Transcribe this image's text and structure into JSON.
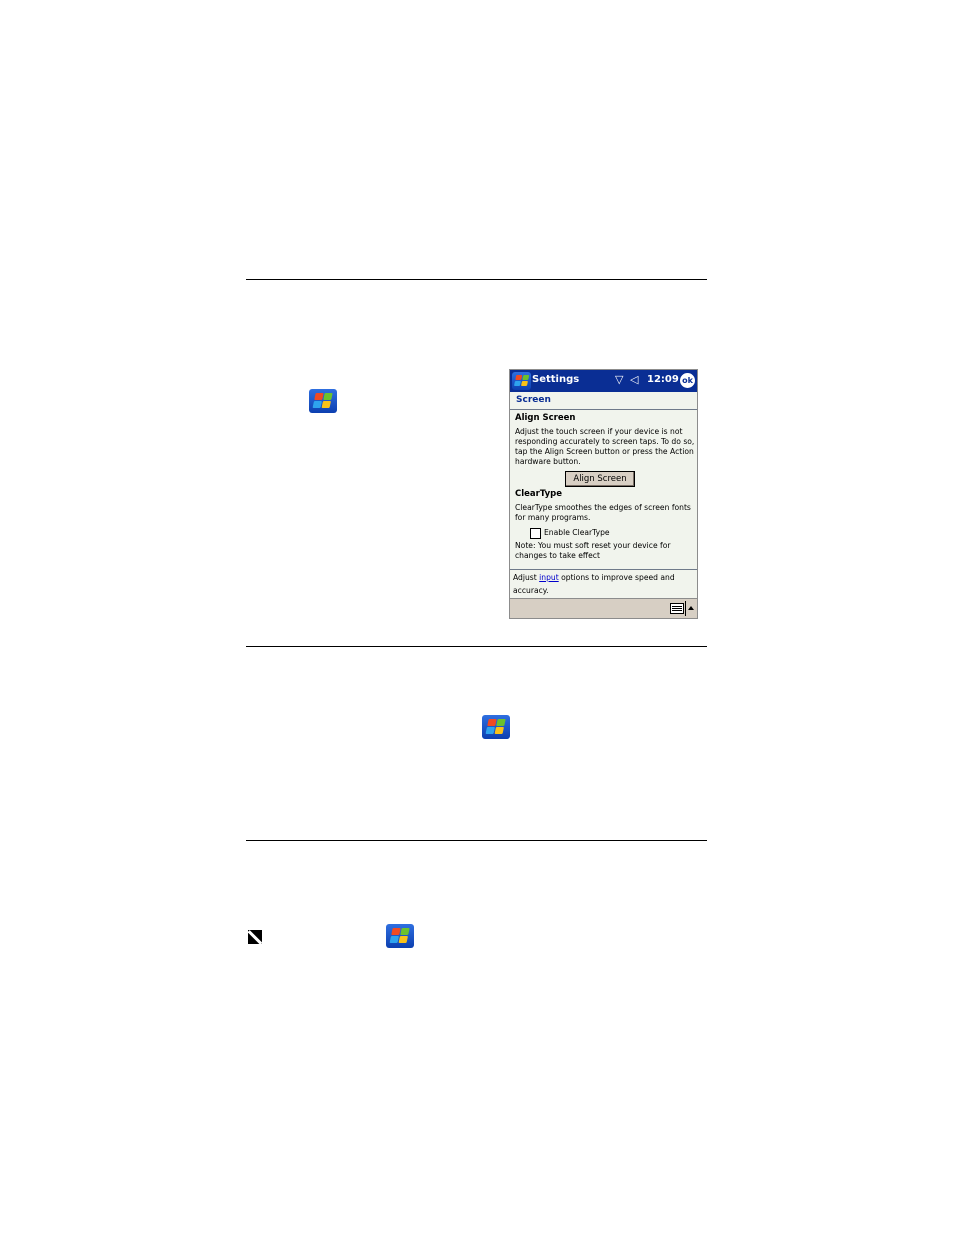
{
  "pda": {
    "title": "Settings",
    "status": {
      "signal_icon": "signal-off-icon",
      "sound_icon": "speaker-icon",
      "time": "12:09",
      "ok_label": "ok"
    },
    "tab_header": "Screen",
    "align_section": {
      "heading": "Align Screen",
      "lines": [
        "Adjust the touch screen if your device is not",
        "responding accurately to screen taps. To do so,",
        "tap the Align Screen button or press the Action",
        "hardware button."
      ],
      "button_label": "Align Screen"
    },
    "cleartype_section": {
      "heading": "ClearType",
      "lines": [
        "ClearType smoothes the edges of screen fonts",
        "for many programs."
      ],
      "checkbox_label": "Enable ClearType",
      "checkbox_checked": false,
      "note_lines": [
        "Note: You must soft reset your device for",
        "changes to take effect"
      ]
    },
    "footer": {
      "prefix": "Adjust ",
      "link_text": "input",
      "suffix": " options to improve speed and",
      "line2": "accuracy."
    },
    "bottom_bar": {
      "keyboard_icon": "keyboard-icon",
      "arrow_icon": "arrow-up-icon"
    }
  }
}
